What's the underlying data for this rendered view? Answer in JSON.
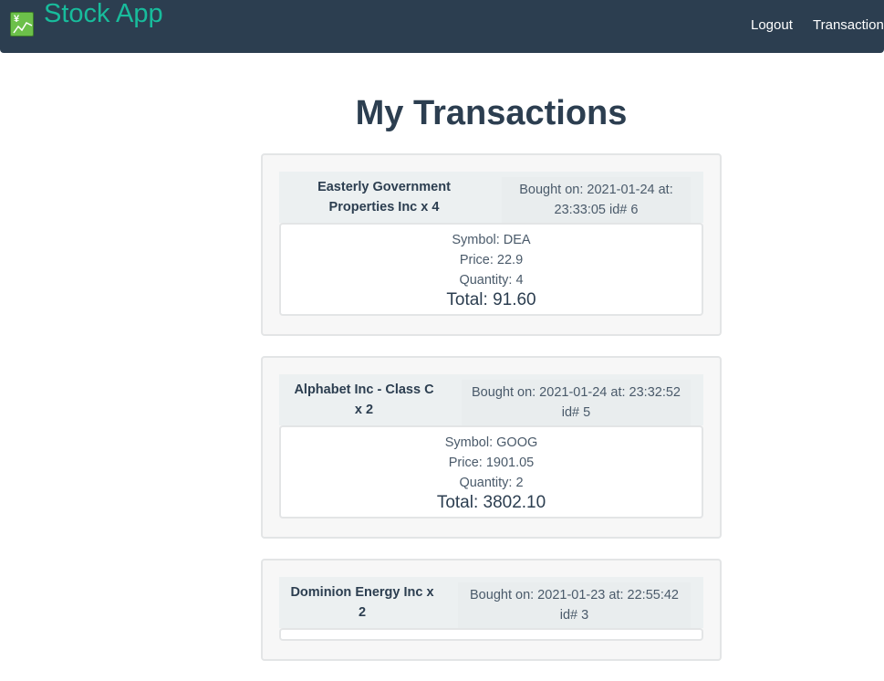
{
  "header": {
    "brand": "Stock App",
    "logo_icon": "yen-chart-icon",
    "nav": {
      "logout": "Logout",
      "transactions": "Transactions"
    }
  },
  "main": {
    "title": "My Transactions",
    "transactions": [
      {
        "name": "Easterly Government Properties Inc x 4",
        "bought": "Bought on: 2021-01-24 at: 23:33:05 id# 6",
        "symbol": "Symbol: DEA",
        "price": "Price: 22.9",
        "quantity": "Quantity: 4",
        "total": "Total: 91.60"
      },
      {
        "name": "Alphabet Inc - Class C x 2",
        "bought": "Bought on: 2021-01-24 at: 23:32:52 id# 5",
        "symbol": "Symbol: GOOG",
        "price": "Price: 1901.05",
        "quantity": "Quantity: 2",
        "total": "Total: 3802.10"
      },
      {
        "name": "Dominion Energy Inc x 2",
        "bought": "Bought on: 2021-01-23 at: 22:55:42 id# 3",
        "symbol": "",
        "price": "",
        "quantity": "",
        "total": ""
      }
    ]
  },
  "colors": {
    "navbar": "#2c3e50",
    "brand": "#18bc9c",
    "card_bg": "#f7f7f7",
    "header_bg": "#ecf0f1"
  }
}
